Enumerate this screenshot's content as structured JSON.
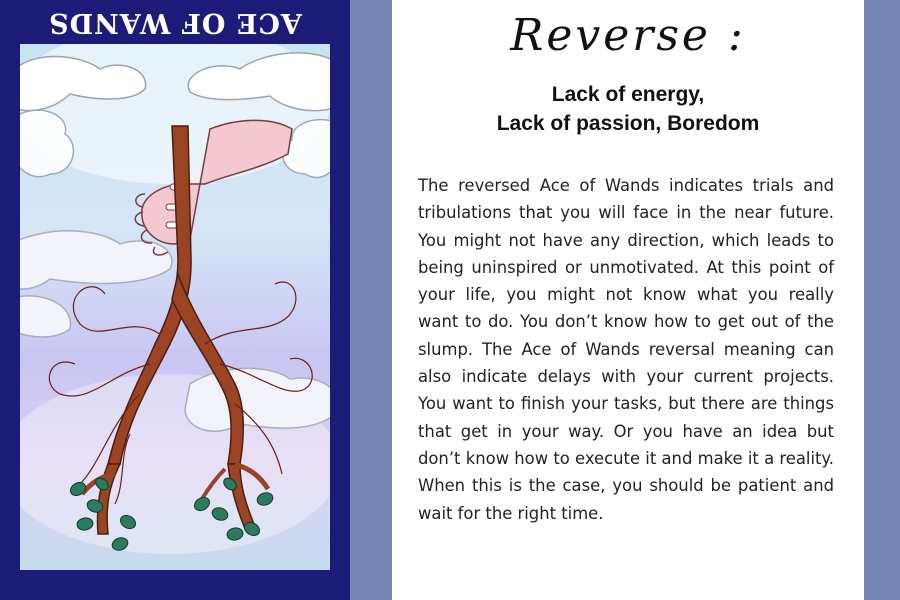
{
  "card": {
    "title": "ACE OF WANDS",
    "title_orientation": "upside-down",
    "colors": {
      "frame": "#1c1c78",
      "wand": "#9a4424",
      "leaves": "#2e7a5e",
      "hand": "#f4c9cf"
    }
  },
  "panel": {
    "heading": "Reverse :",
    "keywords": {
      "line1": "Lack of energy,",
      "line2": "Lack of passion, Boredom"
    },
    "body": "The reversed Ace of Wands indicates trials and tribulations that you will face in the near future. You might not have any direction, which leads to being uninspired or unmotivated. At this point of your life, you might not know what you really want to do. You don’t know how to get out of the slump. The Ace of Wands reversal meaning can also indicate delays with your current projects. You want to finish your tasks, but there are things that get in your way. Or you have an idea but don’t know how to execute it and make it a reality. When this is the case, you should be patient and wait for the right time."
  }
}
